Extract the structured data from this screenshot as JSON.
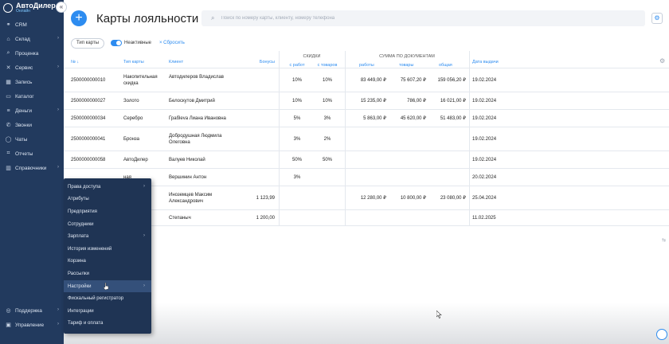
{
  "app": {
    "name": "АвтоДилер",
    "sub": "Онлайн"
  },
  "sidebar": {
    "items": [
      {
        "label": "CRM",
        "icon": "handshake-icon",
        "glyph": "⚭",
        "arrow": false
      },
      {
        "label": "Склад",
        "icon": "warehouse-icon",
        "glyph": "⌂",
        "arrow": true
      },
      {
        "label": "Проценка",
        "icon": "search-icon",
        "glyph": "⌕",
        "arrow": false
      },
      {
        "label": "Сервис",
        "icon": "wrench-icon",
        "glyph": "✕",
        "arrow": true
      },
      {
        "label": "Запись",
        "icon": "calendar-icon",
        "glyph": "▦",
        "arrow": false
      },
      {
        "label": "Каталог",
        "icon": "car-icon",
        "glyph": "▭",
        "arrow": false
      },
      {
        "label": "Деньги",
        "icon": "money-icon",
        "glyph": "≡",
        "arrow": true
      },
      {
        "label": "Звонки",
        "icon": "phone-icon",
        "glyph": "✆",
        "arrow": false
      },
      {
        "label": "Чаты",
        "icon": "chat-icon",
        "glyph": "◯",
        "arrow": false
      },
      {
        "label": "Отчеты",
        "icon": "report-icon",
        "glyph": "⌗",
        "arrow": false
      },
      {
        "label": "Справочники",
        "icon": "book-icon",
        "glyph": "▥",
        "arrow": true
      }
    ],
    "bottom": [
      {
        "label": "Поддержка",
        "icon": "support-icon",
        "glyph": "◎",
        "arrow": true
      },
      {
        "label": "Управление",
        "icon": "settings-icon",
        "glyph": "▣",
        "arrow": true
      }
    ]
  },
  "flyout": {
    "items": [
      {
        "label": "Права доступа",
        "arrow": true
      },
      {
        "label": "Атрибуты",
        "arrow": false
      },
      {
        "label": "Предприятия",
        "arrow": false
      },
      {
        "label": "Сотрудники",
        "arrow": false
      },
      {
        "label": "Зарплата",
        "arrow": true
      },
      {
        "label": "История изменений",
        "arrow": false
      },
      {
        "label": "Корзина",
        "arrow": false
      },
      {
        "label": "Рассылки",
        "arrow": false
      },
      {
        "label": "Настройки",
        "arrow": true,
        "active": true
      },
      {
        "label": "Фискальный регистратор",
        "arrow": false
      },
      {
        "label": "Интеграции",
        "arrow": false
      },
      {
        "label": "Тариф и оплата",
        "arrow": false
      }
    ]
  },
  "header": {
    "add": "+",
    "title": "Карты лояльности",
    "search_placeholder": "Поиск по номеру карты, клиенту, номеру телефона"
  },
  "filters": {
    "card_type": "Тип карты",
    "inactive": "Неактивные",
    "reset": "Сбросить"
  },
  "table": {
    "columns": {
      "number": "№ ↓",
      "type": "Тип карты",
      "client": "Клиент",
      "bonuses": "Бонусы",
      "discounts": "СКИДКИ",
      "disc_work": "с работ",
      "disc_goods": "с товаров",
      "docs": "СУММА ПО ДОКУМЕНТАМ",
      "sum_work": "работы",
      "sum_goods": "товары",
      "sum_total": "общая",
      "date": "Дата выдачи"
    },
    "rows": [
      {
        "number": "2500000000010",
        "type": "Накопительная скидка",
        "client": "Автодилеров Владислав",
        "bonuses": "",
        "disc_work": "10%",
        "disc_goods": "10%",
        "sum_work": "83 449,00 ₽",
        "sum_goods": "75 607,20 ₽",
        "sum_total": "159 056,20 ₽",
        "date": "19.02.2024"
      },
      {
        "number": "2500000000027",
        "type": "Золото",
        "client": "Белоскутов Дмитрий",
        "bonuses": "",
        "disc_work": "10%",
        "disc_goods": "10%",
        "sum_work": "15 235,00 ₽",
        "sum_goods": "786,00 ₽",
        "sum_total": "16 021,00 ₽",
        "date": "19.02.2024"
      },
      {
        "number": "2500000000034",
        "type": "Серебро",
        "client": "Грабleva Лиана Ивановна",
        "bonuses": "",
        "disc_work": "5%",
        "disc_goods": "3%",
        "sum_work": "5 863,00 ₽",
        "sum_goods": "45 620,00 ₽",
        "sum_total": "51 483,00 ₽",
        "date": "19.02.2024"
      },
      {
        "number": "2500000000041",
        "type": "Бронза",
        "client": "Добродушная Людмила Олеговна",
        "bonuses": "",
        "disc_work": "3%",
        "disc_goods": "2%",
        "sum_work": "",
        "sum_goods": "",
        "sum_total": "",
        "date": "19.02.2024"
      },
      {
        "number": "2500000000058",
        "type": "АвтоДилер",
        "client": "Валуев Николай",
        "bonuses": "",
        "disc_work": "50%",
        "disc_goods": "50%",
        "sum_work": "",
        "sum_goods": "",
        "sum_total": "",
        "date": "19.02.2024"
      },
      {
        "number": "",
        "type": "ная",
        "client": "Вершинин Антон",
        "bonuses": "",
        "disc_work": "3%",
        "disc_goods": "",
        "sum_work": "",
        "sum_goods": "",
        "sum_total": "",
        "date": "20.02.2024"
      },
      {
        "number": "",
        "type": "",
        "client": "Иноземцев Максим Александрович",
        "bonuses": "1 123,99",
        "disc_work": "",
        "disc_goods": "",
        "sum_work": "12 280,00 ₽",
        "sum_goods": "10 800,00 ₽",
        "sum_total": "23 080,00 ₽",
        "date": "25.04.2024"
      },
      {
        "number": "",
        "type": "",
        "client": "Степаныч",
        "bonuses": "1 200,00",
        "disc_work": "",
        "disc_goods": "",
        "sum_work": "",
        "sum_goods": "",
        "sum_total": "",
        "date": "11.02.2025"
      }
    ]
  },
  "colors": {
    "sidebar": "#223a5e",
    "accent": "#2d8cf0"
  }
}
